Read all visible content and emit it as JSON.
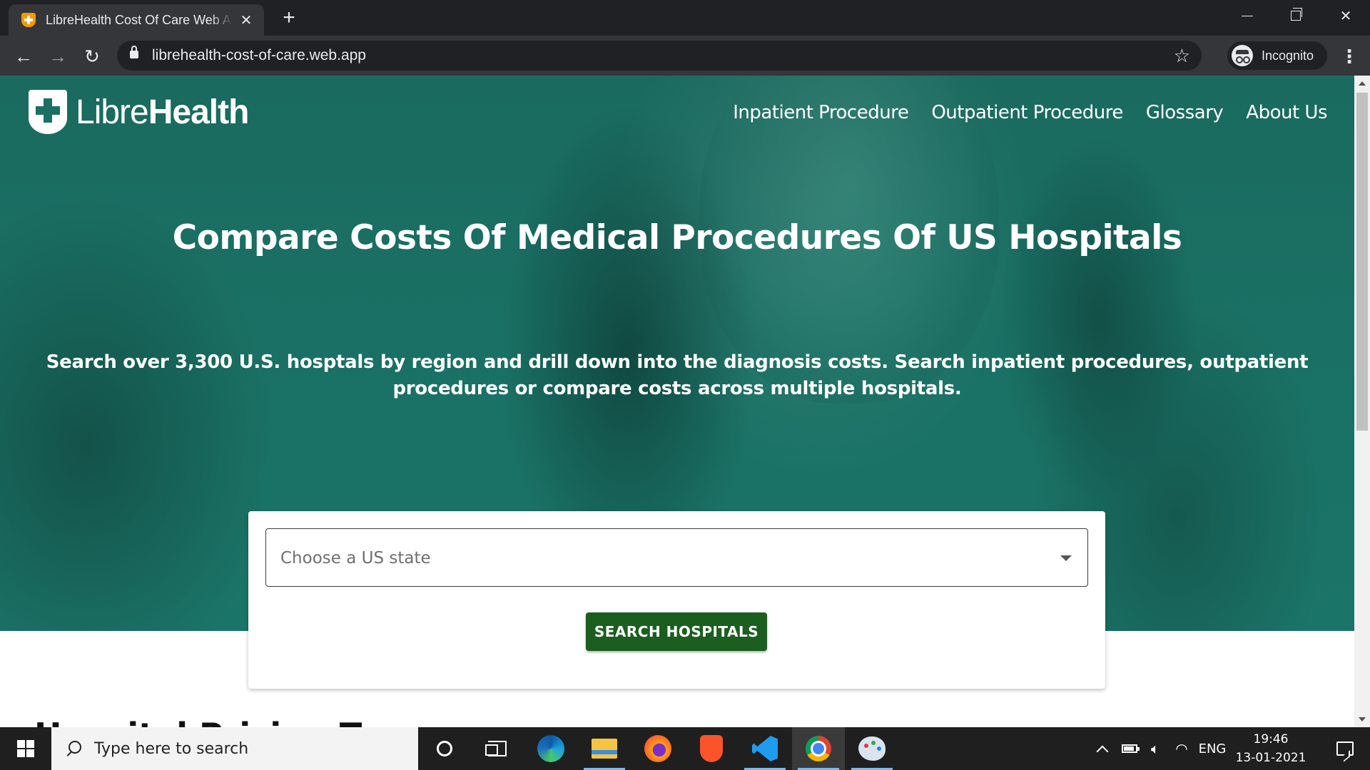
{
  "browser": {
    "tab_title": "LibreHealth Cost Of Care Web App",
    "tab_close": "✕",
    "new_tab": "+",
    "url": "librehealth-cost-of-care.web.app",
    "profile_label": "Incognito"
  },
  "site": {
    "logo_libre": "Libre",
    "logo_health": "Health",
    "nav": [
      {
        "label": "Inpatient Procedure"
      },
      {
        "label": "Outpatient Procedure"
      },
      {
        "label": "Glossary"
      },
      {
        "label": "About Us"
      }
    ],
    "hero_title": "Compare Costs Of Medical Procedures Of US Hospitals",
    "hero_subtitle": "Search over 3,300 U.S. hosptals by region and drill down into the diagnosis costs. Search inpatient procedures, outpatient procedures or compare costs across multiple hospitals.",
    "state_select_placeholder": "Choose a US state",
    "search_button": "SEARCH HOSPITALS",
    "next_section_heading": "Hospital Pricing T"
  },
  "taskbar": {
    "search_placeholder": "Type here to search",
    "language": "ENG",
    "time": "19:46",
    "date": "13-01-2021"
  },
  "colors": {
    "hero_teal": "#1b7064",
    "button_green": "#1b5e20",
    "favicon_orange": "#f29900",
    "chrome_dark": "#202124",
    "chrome_toolbar": "#35363a"
  }
}
